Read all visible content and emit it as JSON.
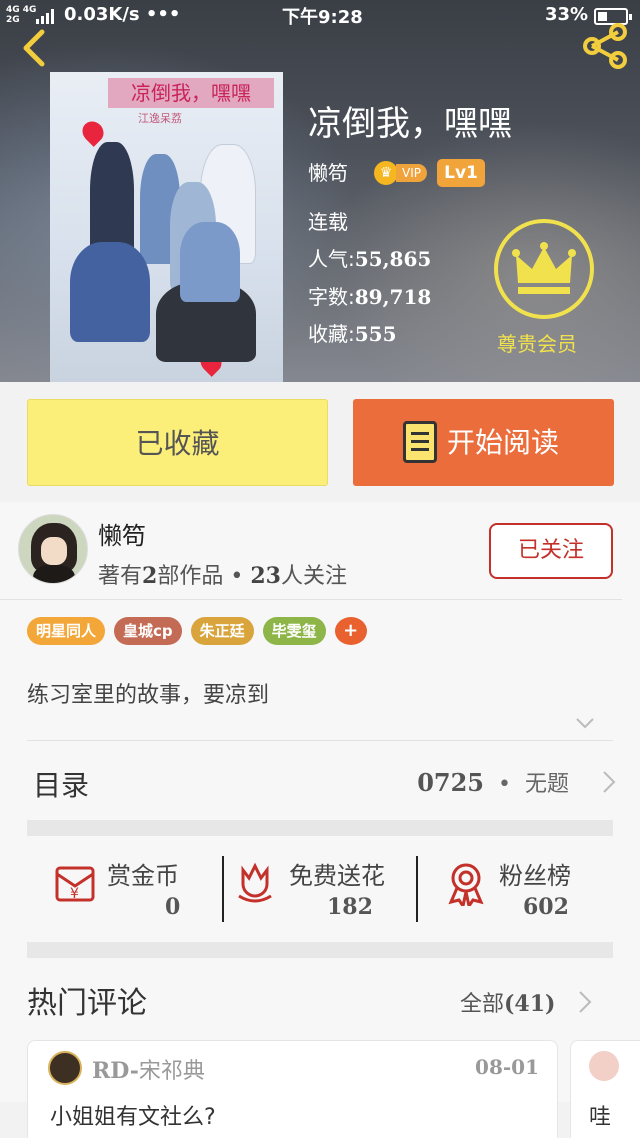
{
  "status_bar": {
    "network": "4G 4G",
    "network2": "2G",
    "speed": "0.03K/s •••",
    "time": "下午9:28",
    "battery": "33%"
  },
  "book": {
    "cover_title": "凉倒我，嘿嘿",
    "cover_subtitle": "江逸呆荔",
    "title": "凉倒我，嘿嘿",
    "author": "懒笱",
    "vip": "VIP",
    "level": "Lv1",
    "status": "连载",
    "popularity_label": "人气:",
    "popularity": "55,865",
    "words_label": "字数:",
    "words": "89,718",
    "favorites_label": "收藏:",
    "favorites": "555",
    "member_label": "尊贵会员"
  },
  "actions": {
    "collected": "已收藏",
    "start_reading": "开始阅读"
  },
  "author_panel": {
    "name": "懒笱",
    "works_prefix": "著有",
    "works_count": "2",
    "works_suffix": "部作品 •",
    "followers_count": "23",
    "followers_suffix": "人关注",
    "follow_button": "已关注"
  },
  "tags": [
    {
      "label": "明星同人",
      "color": "#f3a739"
    },
    {
      "label": "皇城cp",
      "color": "#c46b55"
    },
    {
      "label": "朱正廷",
      "color": "#d9a43b"
    },
    {
      "label": "毕雯玺",
      "color": "#8db548"
    }
  ],
  "tag_add": "+",
  "summary": "练习室里的故事，要凉到",
  "toc": {
    "label": "目录",
    "latest_num": "0725",
    "latest_sep": "•",
    "latest_title": "无题"
  },
  "stats": {
    "coins_label": "赏金币",
    "coins": "0",
    "flowers_label": "免费送花",
    "flowers": "182",
    "fans_label": "粉丝榜",
    "fans": "602"
  },
  "hot_comments": {
    "title": "热门评论",
    "all_label": "全部",
    "all_count": "(41)",
    "items": [
      {
        "user_prefix": "RD-",
        "user": "宋祁典",
        "date": "08-01",
        "text": "小姐姐有文社么?"
      },
      {
        "text": "哇"
      }
    ]
  },
  "colors": {
    "accent_orange": "#ea6d3b",
    "collected_yellow": "#fbef79",
    "follow_red": "#c4302a",
    "member_yellow": "#f1e24d"
  }
}
